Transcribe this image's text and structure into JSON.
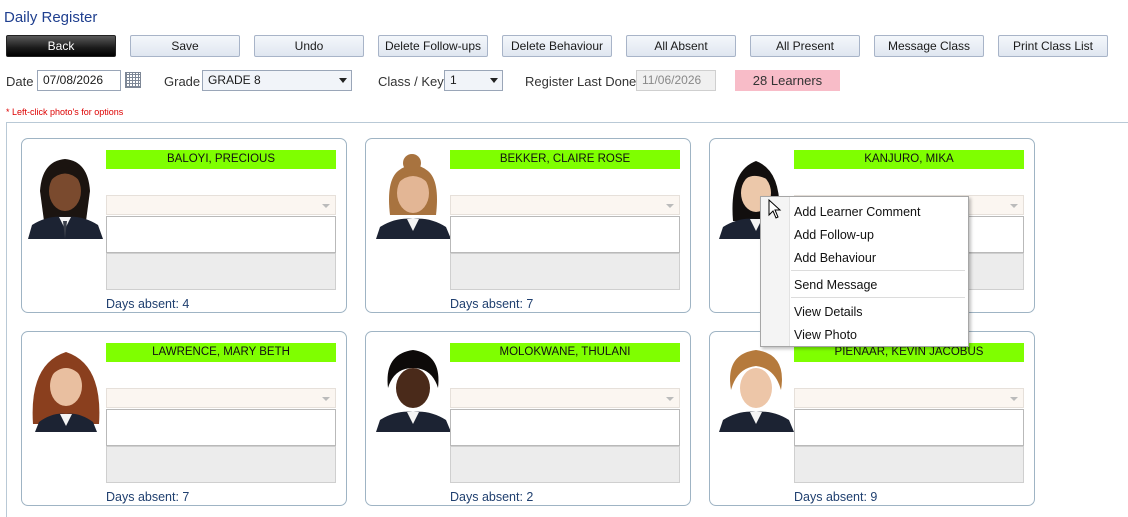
{
  "window": {
    "title": "Daily Register"
  },
  "toolbar": {
    "back": "Back",
    "save": "Save",
    "undo": "Undo",
    "delete_followups": "Delete Follow-ups",
    "delete_behaviour": "Delete Behaviour",
    "all_absent": "All Absent",
    "all_present": "All Present",
    "message_class": "Message Class",
    "print_class_list": "Print Class List"
  },
  "filters": {
    "date_label": "Date",
    "date_value": "07/08/2026",
    "grade_label": "Grade",
    "grade_value": "GRADE 8",
    "class_label": "Class / Key",
    "class_value": "1",
    "last_done_label": "Register Last Done",
    "last_done_value": "11/06/2026",
    "learners_badge": "28 Learners"
  },
  "hint": "* Left-click photo's for options",
  "learners": [
    {
      "name": "BALOYI, PRECIOUS",
      "days": "Days absent: 4"
    },
    {
      "name": "BEKKER, CLAIRE ROSE",
      "days": "Days absent: 7"
    },
    {
      "name": "KANJURO, MIKA",
      "days": ""
    },
    {
      "name": "LAWRENCE, MARY BETH",
      "days": "Days absent: 7"
    },
    {
      "name": "MOLOKWANE, THULANI",
      "days": "Days absent: 2"
    },
    {
      "name": "PIENAAR, KEVIN JACOBUS",
      "days": "Days absent: 9"
    }
  ],
  "context_menu": {
    "items": [
      "Add Learner Comment",
      "Add Follow-up",
      "Add Behaviour",
      "Send Message",
      "View Details",
      "View Photo"
    ]
  },
  "colors": {
    "name_bar": "#7fff00",
    "learners_badge": "#f8bcc8",
    "title": "#1f3f8f"
  }
}
